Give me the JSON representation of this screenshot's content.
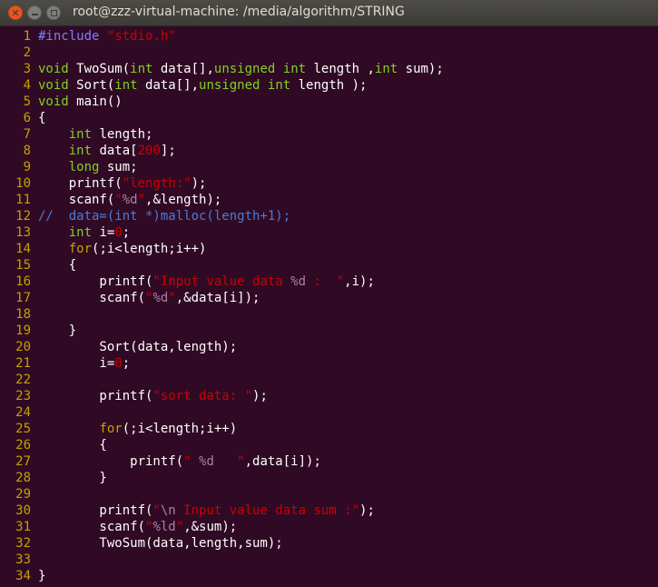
{
  "window": {
    "title": "root@zzz-virtual-machine: /media/algorithm/STRING"
  },
  "editor": {
    "lines": [
      {
        "n": "1",
        "tokens": [
          {
            "t": "#include ",
            "c": "pp"
          },
          {
            "t": "\"stdio.h\"",
            "c": "str"
          }
        ]
      },
      {
        "n": "2",
        "tokens": []
      },
      {
        "n": "3",
        "tokens": [
          {
            "t": "void",
            "c": "type"
          },
          {
            "t": " TwoSum(",
            "c": ""
          },
          {
            "t": "int",
            "c": "type"
          },
          {
            "t": " data[],",
            "c": ""
          },
          {
            "t": "unsigned",
            "c": "type"
          },
          {
            "t": " ",
            "c": ""
          },
          {
            "t": "int",
            "c": "type"
          },
          {
            "t": " length ,",
            "c": ""
          },
          {
            "t": "int",
            "c": "type"
          },
          {
            "t": " sum);",
            "c": ""
          }
        ]
      },
      {
        "n": "4",
        "tokens": [
          {
            "t": "void",
            "c": "type"
          },
          {
            "t": " Sort(",
            "c": ""
          },
          {
            "t": "int",
            "c": "type"
          },
          {
            "t": " data[],",
            "c": ""
          },
          {
            "t": "unsigned",
            "c": "type"
          },
          {
            "t": " ",
            "c": ""
          },
          {
            "t": "int",
            "c": "type"
          },
          {
            "t": " length );",
            "c": ""
          }
        ]
      },
      {
        "n": "5",
        "tokens": [
          {
            "t": "void",
            "c": "type"
          },
          {
            "t": " main()",
            "c": ""
          }
        ]
      },
      {
        "n": "6",
        "tokens": [
          {
            "t": "{",
            "c": ""
          }
        ]
      },
      {
        "n": "7",
        "tokens": [
          {
            "t": "    ",
            "c": ""
          },
          {
            "t": "int",
            "c": "type"
          },
          {
            "t": " length;",
            "c": ""
          }
        ]
      },
      {
        "n": "8",
        "tokens": [
          {
            "t": "    ",
            "c": ""
          },
          {
            "t": "int",
            "c": "type"
          },
          {
            "t": " data[",
            "c": ""
          },
          {
            "t": "200",
            "c": "str"
          },
          {
            "t": "];",
            "c": ""
          }
        ]
      },
      {
        "n": "9",
        "tokens": [
          {
            "t": "    ",
            "c": ""
          },
          {
            "t": "long",
            "c": "type"
          },
          {
            "t": " sum;",
            "c": ""
          }
        ]
      },
      {
        "n": "10",
        "tokens": [
          {
            "t": "    printf(",
            "c": ""
          },
          {
            "t": "\"length:\"",
            "c": "str"
          },
          {
            "t": ");",
            "c": ""
          }
        ]
      },
      {
        "n": "11",
        "tokens": [
          {
            "t": "    scanf(",
            "c": ""
          },
          {
            "t": "\"",
            "c": "str"
          },
          {
            "t": "%d",
            "c": "fmt"
          },
          {
            "t": "\"",
            "c": "str"
          },
          {
            "t": ",&length);",
            "c": ""
          }
        ]
      },
      {
        "n": "12",
        "tokens": [
          {
            "t": "//  data=(int *)malloc(length+1);",
            "c": "cmt"
          }
        ]
      },
      {
        "n": "13",
        "tokens": [
          {
            "t": "    ",
            "c": ""
          },
          {
            "t": "int",
            "c": "type"
          },
          {
            "t": " i=",
            "c": ""
          },
          {
            "t": "0",
            "c": "str"
          },
          {
            "t": ";",
            "c": ""
          }
        ]
      },
      {
        "n": "14",
        "tokens": [
          {
            "t": "    ",
            "c": ""
          },
          {
            "t": "for",
            "c": "kw"
          },
          {
            "t": "(;i<length;i++)",
            "c": ""
          }
        ]
      },
      {
        "n": "15",
        "tokens": [
          {
            "t": "    {",
            "c": ""
          }
        ]
      },
      {
        "n": "16",
        "tokens": [
          {
            "t": "        printf(",
            "c": ""
          },
          {
            "t": "\"Input value data ",
            "c": "str"
          },
          {
            "t": "%d",
            "c": "fmt"
          },
          {
            "t": " :  \"",
            "c": "str"
          },
          {
            "t": ",i);",
            "c": ""
          }
        ]
      },
      {
        "n": "17",
        "tokens": [
          {
            "t": "        scanf(",
            "c": ""
          },
          {
            "t": "\"",
            "c": "str"
          },
          {
            "t": "%d",
            "c": "fmt"
          },
          {
            "t": "\"",
            "c": "str"
          },
          {
            "t": ",&data[i]);",
            "c": ""
          }
        ]
      },
      {
        "n": "18",
        "tokens": []
      },
      {
        "n": "19",
        "tokens": [
          {
            "t": "    }",
            "c": ""
          }
        ]
      },
      {
        "n": "20",
        "tokens": [
          {
            "t": "        Sort(data,length);",
            "c": ""
          }
        ]
      },
      {
        "n": "21",
        "tokens": [
          {
            "t": "        i=",
            "c": ""
          },
          {
            "t": "0",
            "c": "str"
          },
          {
            "t": ";",
            "c": ""
          }
        ]
      },
      {
        "n": "22",
        "tokens": []
      },
      {
        "n": "23",
        "tokens": [
          {
            "t": "        printf(",
            "c": ""
          },
          {
            "t": "\"sort data: \"",
            "c": "str"
          },
          {
            "t": ");",
            "c": ""
          }
        ]
      },
      {
        "n": "24",
        "tokens": []
      },
      {
        "n": "25",
        "tokens": [
          {
            "t": "        ",
            "c": ""
          },
          {
            "t": "for",
            "c": "kw"
          },
          {
            "t": "(;i<length;i++)",
            "c": ""
          }
        ]
      },
      {
        "n": "26",
        "tokens": [
          {
            "t": "        {",
            "c": ""
          }
        ]
      },
      {
        "n": "27",
        "tokens": [
          {
            "t": "            printf(",
            "c": ""
          },
          {
            "t": "\" ",
            "c": "str"
          },
          {
            "t": "%d",
            "c": "fmt"
          },
          {
            "t": "   \"",
            "c": "str"
          },
          {
            "t": ",data[i]);",
            "c": ""
          }
        ]
      },
      {
        "n": "28",
        "tokens": [
          {
            "t": "        }",
            "c": ""
          }
        ]
      },
      {
        "n": "29",
        "tokens": []
      },
      {
        "n": "30",
        "tokens": [
          {
            "t": "        printf(",
            "c": ""
          },
          {
            "t": "\"",
            "c": "str"
          },
          {
            "t": "\\n",
            "c": "nl"
          },
          {
            "t": " Input value data sum :\"",
            "c": "str"
          },
          {
            "t": ");",
            "c": ""
          }
        ]
      },
      {
        "n": "31",
        "tokens": [
          {
            "t": "        scanf(",
            "c": ""
          },
          {
            "t": "\"",
            "c": "str"
          },
          {
            "t": "%ld",
            "c": "fmt"
          },
          {
            "t": "\"",
            "c": "str"
          },
          {
            "t": ",&sum);",
            "c": ""
          }
        ]
      },
      {
        "n": "32",
        "tokens": [
          {
            "t": "        TwoSum(data,length,sum);",
            "c": ""
          }
        ]
      },
      {
        "n": "33",
        "tokens": []
      },
      {
        "n": "34",
        "tokens": [
          {
            "t": "}",
            "c": ""
          }
        ]
      }
    ]
  },
  "colors": {
    "background": "#300a24",
    "line_number": "#c4a000",
    "string": "#cc0000",
    "type": "#7ed321",
    "comment": "#4b7bd6",
    "preprocessor": "#7f7fff",
    "close_button": "#e95420"
  },
  "icons": {
    "close": "close-icon",
    "minimize": "minimize-icon",
    "maximize": "maximize-icon"
  }
}
